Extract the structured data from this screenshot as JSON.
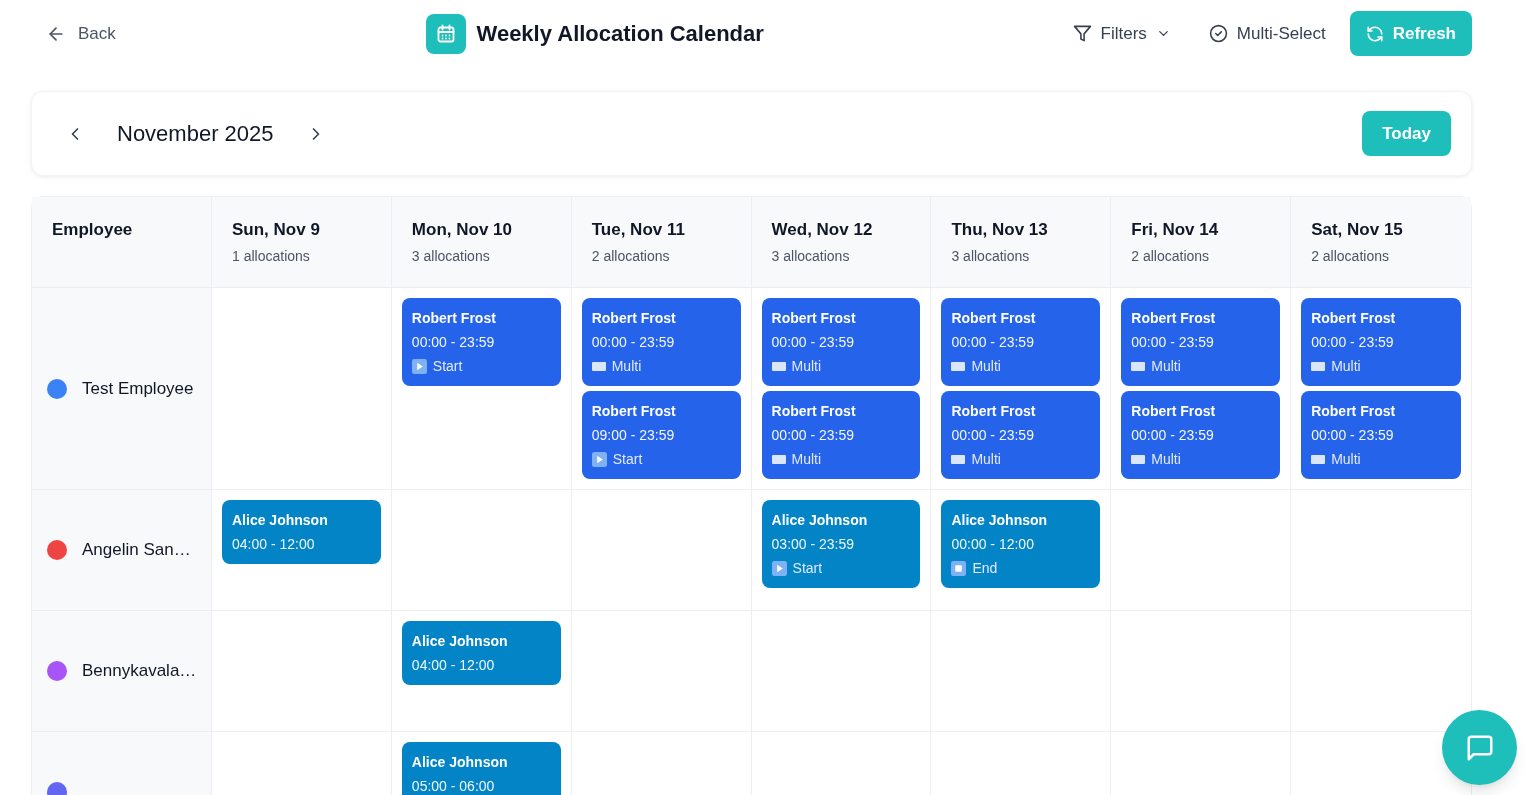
{
  "header": {
    "back": "Back",
    "title": "Weekly Allocation Calendar",
    "filters": "Filters",
    "multi_select": "Multi-Select",
    "refresh": "Refresh"
  },
  "month_bar": {
    "month": "November 2025",
    "today": "Today"
  },
  "calendar": {
    "employee_heading": "Employee",
    "days": [
      {
        "label": "Sun, Nov 9",
        "count": "1 allocations"
      },
      {
        "label": "Mon, Nov 10",
        "count": "3 allocations"
      },
      {
        "label": "Tue, Nov 11",
        "count": "2 allocations"
      },
      {
        "label": "Wed, Nov 12",
        "count": "3 allocations"
      },
      {
        "label": "Thu, Nov 13",
        "count": "3 allocations"
      },
      {
        "label": "Fri, Nov 14",
        "count": "2 allocations"
      },
      {
        "label": "Sat, Nov 15",
        "count": "2 allocations"
      }
    ],
    "rows": [
      {
        "employee": {
          "name": "Test Employee",
          "color": "#3b82f6"
        },
        "cells": [
          null,
          [
            {
              "person": "Robert Frost",
              "time": "00:00 - 23:59",
              "tag": {
                "kind": "start",
                "label": "Start"
              },
              "color": "#2563eb"
            }
          ],
          [
            {
              "person": "Robert Frost",
              "time": "00:00 - 23:59",
              "tag": {
                "kind": "multi",
                "label": "Multi"
              },
              "color": "#2563eb"
            },
            {
              "person": "Robert Frost",
              "time": "09:00 - 23:59",
              "tag": {
                "kind": "start",
                "label": "Start"
              },
              "color": "#2563eb"
            }
          ],
          [
            {
              "person": "Robert Frost",
              "time": "00:00 - 23:59",
              "tag": {
                "kind": "multi",
                "label": "Multi"
              },
              "color": "#2563eb"
            },
            {
              "person": "Robert Frost",
              "time": "00:00 - 23:59",
              "tag": {
                "kind": "multi",
                "label": "Multi"
              },
              "color": "#2563eb"
            }
          ],
          [
            {
              "person": "Robert Frost",
              "time": "00:00 - 23:59",
              "tag": {
                "kind": "multi",
                "label": "Multi"
              },
              "color": "#2563eb"
            },
            {
              "person": "Robert Frost",
              "time": "00:00 - 23:59",
              "tag": {
                "kind": "multi",
                "label": "Multi"
              },
              "color": "#2563eb"
            }
          ],
          [
            {
              "person": "Robert Frost",
              "time": "00:00 - 23:59",
              "tag": {
                "kind": "multi",
                "label": "Multi"
              },
              "color": "#2563eb"
            },
            {
              "person": "Robert Frost",
              "time": "00:00 - 23:59",
              "tag": {
                "kind": "multi",
                "label": "Multi"
              },
              "color": "#2563eb"
            }
          ],
          [
            {
              "person": "Robert Frost",
              "time": "00:00 - 23:59",
              "tag": {
                "kind": "multi",
                "label": "Multi"
              },
              "color": "#2563eb"
            },
            {
              "person": "Robert Frost",
              "time": "00:00 - 23:59",
              "tag": {
                "kind": "multi",
                "label": "Multi"
              },
              "color": "#2563eb"
            }
          ]
        ]
      },
      {
        "employee": {
          "name": "Angelin San…",
          "color": "#ef4444"
        },
        "cells": [
          [
            {
              "person": "Alice Johnson",
              "time": "04:00 - 12:00",
              "color": "#0284c7"
            }
          ],
          null,
          null,
          [
            {
              "person": "Alice Johnson",
              "time": "03:00 - 23:59",
              "tag": {
                "kind": "start",
                "label": "Start"
              },
              "color": "#0284c7"
            }
          ],
          [
            {
              "person": "Alice Johnson",
              "time": "00:00 - 12:00",
              "tag": {
                "kind": "end",
                "label": "End"
              },
              "color": "#0284c7"
            }
          ],
          null,
          null
        ]
      },
      {
        "employee": {
          "name": "Bennykavala…",
          "color": "#a855f7"
        },
        "cells": [
          null,
          [
            {
              "person": "Alice Johnson",
              "time": "04:00 - 12:00",
              "color": "#0284c7"
            }
          ],
          null,
          null,
          null,
          null,
          null
        ]
      },
      {
        "employee": {
          "color": "#6366f1"
        },
        "cells": [
          null,
          [
            {
              "person": "Alice Johnson",
              "time": "05:00 - 06:00",
              "color": "#0284c7"
            }
          ],
          null,
          null,
          null,
          null,
          null
        ]
      }
    ]
  }
}
